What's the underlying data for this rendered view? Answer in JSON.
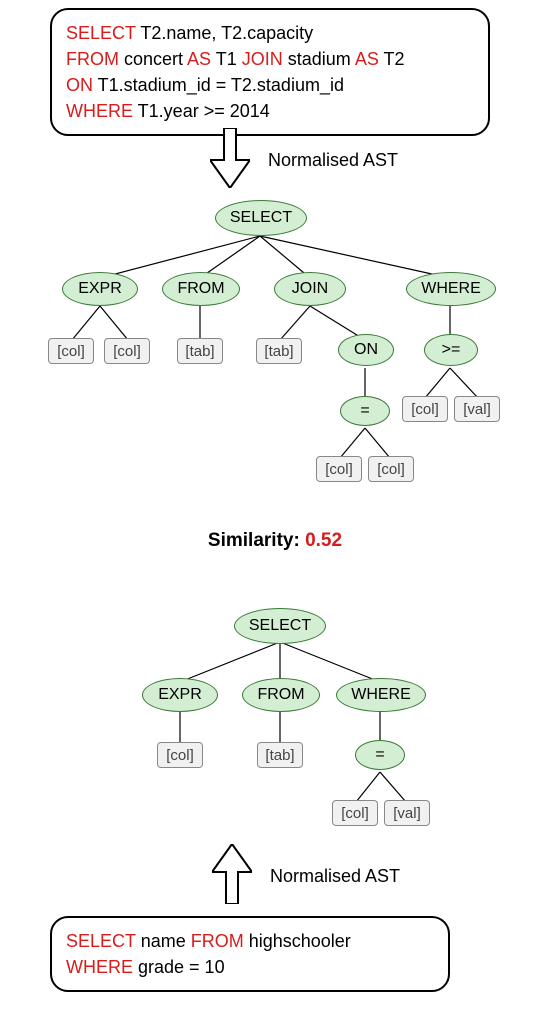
{
  "sql_top": {
    "line1": {
      "p1": "SELECT",
      "p2": " T2.name, T2.capacity"
    },
    "line2": {
      "p1": "FROM",
      "p2": " concert ",
      "p3": "AS",
      "p4": " T1 ",
      "p5": "JOIN",
      "p6": " stadium ",
      "p7": "AS",
      "p8": " T2"
    },
    "line3": {
      "p1": "ON",
      "p2": " T1.stadium_id = T2.stadium_id"
    },
    "line4": {
      "p1": "WHERE",
      "p2": " T1.year >= 2014"
    }
  },
  "sql_bottom": {
    "line1": {
      "p1": "SELECT",
      "p2": " name ",
      "p3": "FROM",
      "p4": " highschooler"
    },
    "line2": {
      "p1": "WHERE",
      "p2": " grade = 10"
    }
  },
  "labels": {
    "normalised_ast_top": "Normalised AST",
    "normalised_ast_bottom": "Normalised AST",
    "similarity_label": "Similarity: ",
    "similarity_value": "0.52"
  },
  "tree_top": {
    "nodes": {
      "select": "SELECT",
      "expr": "EXPR",
      "from": "FROM",
      "join": "JOIN",
      "where": "WHERE",
      "on": "ON",
      "eq": "=",
      "ge": ">="
    },
    "leaves": {
      "expr_col1": "[col]",
      "expr_col2": "[col]",
      "from_tab": "[tab]",
      "join_tab": "[tab]",
      "eq_col1": "[col]",
      "eq_col2": "[col]",
      "ge_col": "[col]",
      "ge_val": "[val]"
    }
  },
  "tree_bottom": {
    "nodes": {
      "select": "SELECT",
      "expr": "EXPR",
      "from": "FROM",
      "where": "WHERE",
      "eq": "="
    },
    "leaves": {
      "expr_col": "[col]",
      "from_tab": "[tab]",
      "eq_col": "[col]",
      "eq_val": "[val]"
    }
  },
  "chart_data": {
    "type": "table",
    "title": "SQL AST similarity example",
    "queries": [
      "SELECT T2.name, T2.capacity FROM concert AS T1 JOIN stadium AS T2 ON T1.stadium_id = T2.stadium_id WHERE T1.year >= 2014",
      "SELECT name FROM highschooler WHERE grade = 10"
    ],
    "similarity": 0.52,
    "ast_top": {
      "SELECT": {
        "EXPR": [
          "[col]",
          "[col]"
        ],
        "FROM": [
          "[tab]"
        ],
        "JOIN": {
          "leaf": "[tab]",
          "ON": {
            "=": [
              "[col]",
              "[col]"
            ]
          }
        },
        "WHERE": {
          ">=": [
            "[col]",
            "[val]"
          ]
        }
      }
    },
    "ast_bottom": {
      "SELECT": {
        "EXPR": [
          "[col]"
        ],
        "FROM": [
          "[tab]"
        ],
        "WHERE": {
          "=": [
            "[col]",
            "[val]"
          ]
        }
      }
    }
  }
}
